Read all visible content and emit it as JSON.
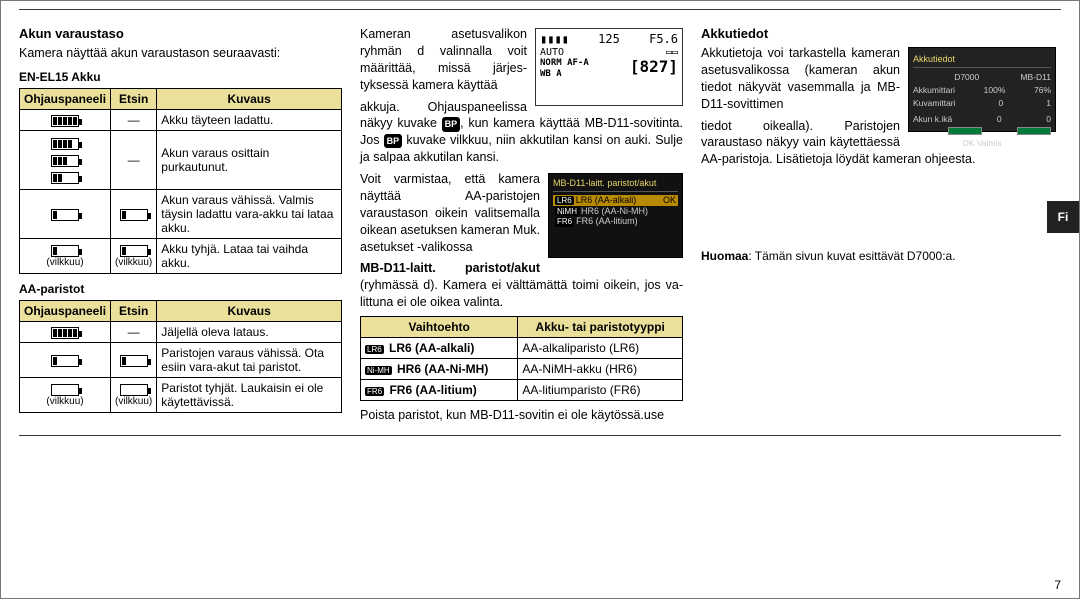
{
  "langTab": "Fi",
  "pageNumber": "7",
  "col1": {
    "h_akun": "Akun varaustaso",
    "p_intro": "Kamera näyttää akun varaustason seuraavasti:",
    "h_en": "EN-EL15 Akku",
    "th_ohj": "Ohjauspaneeli",
    "th_etsin": "Etsin",
    "th_kuvaus": "Kuvaus",
    "dash": "—",
    "r1": "Akku täyteen ladattu.",
    "r2": "Akun varaus osittain purkautunut.",
    "r3": "Akun varaus vähissä. Valmis täysin ladattu vara-akku tai lataa akku.",
    "r4": "Akku tyhjä. Lataa tai vaihda akku.",
    "vilkku": "(vilkkuu)",
    "h_aa": "AA-paristot",
    "aa_r1": "Jäljellä oleva lataus.",
    "aa_r2": "Paristojen varaus vähissä. Ota esiin vara-akut tai paristot.",
    "aa_r3": "Paristot tyhjät. Laukaisin ei ole käytettävissä."
  },
  "col2": {
    "p1a": "Kameran asetusvalikon ryhmän d valinnalla voit määrittää, missä järjes­tyksessä kamera käyttää",
    "p1b_pre": "akkuja. Ohjauspaneelissa näkyy kuvake ",
    "p1b_mid": ", kun kamera käyttää MB-D11-sovitinta. Jos ",
    "p1b_post": " kuvake vilkkuu, niin akkutilan kansi on auki. Sulje ja sal­paa akkutilan kansi.",
    "bp": "BP",
    "p2": "Voit varmistaa, että ka­mera näyttää AA-paris­tojen varaustason oikein valitsemalla oikean ase­tuksen kameran Muk. asetukset -valikossa",
    "mbd_label": "MB-D11-laitt. paristot/akut",
    "p3": " (ryhmässä d). Kamera ei välttämättä toimi oikein, jos va­littuna ei ole oikea valinta.",
    "th_vaihto": "Vaihtoehto",
    "th_tyyppi": "Akku- tai paristotyyppi",
    "opt1a": "LR6 (AA-alkali)",
    "opt1b": "AA-alkaliparisto (LR6)",
    "opt2a": "HR6 (AA-Ni-MH)",
    "opt2b": "AA-NiMH-akku (HR6)",
    "opt3a": "FR6 (AA-litium)",
    "opt3b": "AA-litiumparisto (FR6)",
    "code1": "LR6",
    "code2": "Ni-MH",
    "code3": "FR6",
    "p4": "Poista paristot, kun MB-D11-sovitin ei ole käytös­sä.use",
    "lcd": {
      "l1a": "125",
      "l1b": "F5.6",
      "l2": "827"
    },
    "menu": {
      "title": "MB-D11-laitt. paristot/akut",
      "i1": "LR6 (AA-alkali)",
      "i2": "HR6 (AA-Ni-MH)",
      "i3": "FR6 (AA-litium)"
    }
  },
  "col3": {
    "h": "Akkutiedot",
    "p1": "Akkutietoja voi tar­kastella kameran ase­tusvalikossa (kame­ran akun tiedot nä­kyvät vasemmalla ja MB-D11-sovittimen",
    "p2": "tiedot oikealla). Paristojen varaustaso näkyy vain käytettäessä AA-paristoja. Lisätietoja löy­dät kameran ohjeesta.",
    "panel": {
      "title": "Akkutiedot",
      "colA": "D7000",
      "colB": "MB-D11",
      "r1": "Akkumittari",
      "r1a": "100%",
      "r1b": "76%",
      "r2": "Kuvamittari",
      "r2a": "0",
      "r2b": "1",
      "r3": "Akun k.ikä",
      "r3a": "0",
      "r3b": "0",
      "ok": "OK Valmis"
    },
    "note_b": "Huomaa",
    "note": ": Tämän sivun kuvat esittävät D7000:a."
  }
}
